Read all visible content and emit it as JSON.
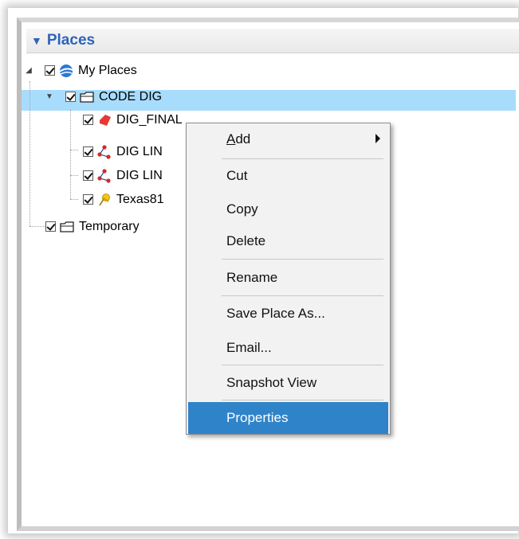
{
  "panel": {
    "title": "Places",
    "collapse_glyph": "▼"
  },
  "tree": {
    "my_places": {
      "label": "My Places",
      "icon": "earth-icon",
      "checked": true
    },
    "code_dig": {
      "label": "CODE DIG",
      "icon": "folder-icon",
      "checked": true
    },
    "items": [
      {
        "label": "DIG_FINAL",
        "icon": "polygon-icon",
        "checked": true,
        "selected": true
      },
      {
        "label": "DIG LIN",
        "icon": "path-icon",
        "checked": true
      },
      {
        "label": "DIG LIN",
        "icon": "path-icon",
        "checked": true
      },
      {
        "label": "Texas81",
        "icon": "pushpin-icon",
        "checked": true
      }
    ],
    "temporary": {
      "label": "Temporary",
      "icon": "folder-icon",
      "checked": true
    }
  },
  "context_menu": {
    "items": [
      {
        "label_prefix": "",
        "label_ul": "A",
        "label_rest": "dd",
        "has_submenu": true
      },
      {
        "label": "Cut"
      },
      {
        "label": "Copy"
      },
      {
        "label": "Delete"
      },
      {
        "label": "Rename"
      },
      {
        "label": "Save Place As..."
      },
      {
        "label": "Email..."
      },
      {
        "label": "Snapshot View"
      },
      {
        "label": "Properties",
        "highlighted": true
      }
    ]
  },
  "colors": {
    "header_text": "#2f63b9",
    "selection": "#a8dcfd",
    "menu_highlight": "#2f84c9"
  }
}
